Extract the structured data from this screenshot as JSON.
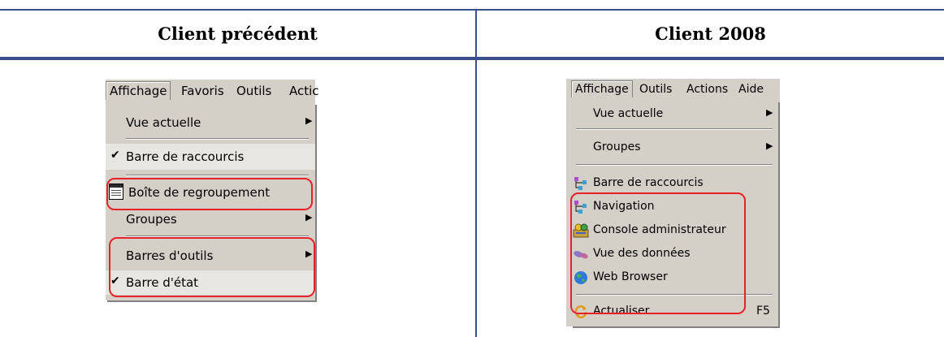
{
  "table": {
    "left_header": "Client précédent",
    "right_header": "Client 2008"
  },
  "left_menu": {
    "menubar": [
      "Affichage",
      "Favoris",
      "Outils",
      "Actic"
    ],
    "items": {
      "vue_actuelle": "Vue actuelle",
      "barre_raccourcis": "Barre de raccourcis",
      "boite_regroupement": "Boîte de regroupement",
      "groupes": "Groupes",
      "barres_outils": "Barres d'outils",
      "barre_etat": "Barre d'état"
    }
  },
  "right_menu": {
    "menubar": [
      "Affichage",
      "Outils",
      "Actions",
      "Aide"
    ],
    "items": {
      "vue_actuelle": "Vue actuelle",
      "groupes": "Groupes",
      "barre_raccourcis": "Barre de raccourcis",
      "navigation": "Navigation",
      "console_admin": "Console administrateur",
      "vue_donnees": "Vue des données",
      "web_browser": "Web Browser",
      "actualiser": "Actualiser",
      "actualiser_key": "F5"
    }
  },
  "colors": {
    "rule": "#3a4f8c",
    "menu_bg": "#d4d0c8",
    "highlight": "#e8202a"
  }
}
